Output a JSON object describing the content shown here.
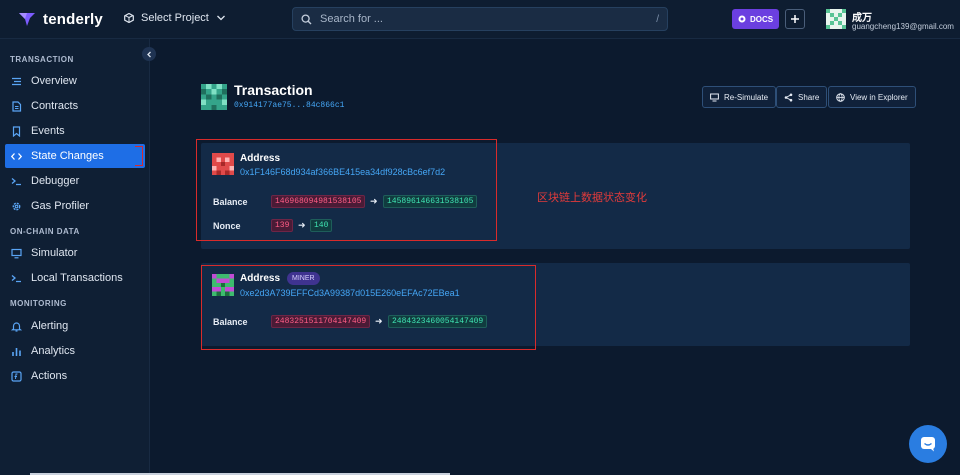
{
  "app": {
    "brand": "tenderly"
  },
  "topbar": {
    "project_label": "Select Project",
    "search_placeholder": "Search for ...",
    "search_shortcut": "/",
    "docs_label": "DOCS",
    "user_name": "成万",
    "user_email": "guangcheng139@gmail.com"
  },
  "sidebar": {
    "sections": [
      {
        "title": "TRANSACTION"
      },
      {
        "title": "ON-CHAIN DATA"
      },
      {
        "title": "MONITORING"
      }
    ],
    "items": [
      {
        "label": "Overview",
        "icon": "list-icon"
      },
      {
        "label": "Contracts",
        "icon": "file-icon"
      },
      {
        "label": "Events",
        "icon": "bookmark-icon"
      },
      {
        "label": "State Changes",
        "icon": "code-icon",
        "active": true
      },
      {
        "label": "Debugger",
        "icon": "terminal-icon"
      },
      {
        "label": "Gas Profiler",
        "icon": "gear-icon"
      },
      {
        "label": "Simulator",
        "icon": "monitor-icon"
      },
      {
        "label": "Local Transactions",
        "icon": "terminal-icon"
      },
      {
        "label": "Alerting",
        "icon": "bell-icon"
      },
      {
        "label": "Analytics",
        "icon": "bar-chart-icon"
      },
      {
        "label": "Actions",
        "icon": "function-icon"
      }
    ]
  },
  "transaction": {
    "title": "Transaction",
    "hash": "0x914177ae75...84c866c1",
    "buttons": {
      "resimulate": "Re-Simulate",
      "share": "Share",
      "explorer": "View in Explorer"
    }
  },
  "state_changes": [
    {
      "label": "Address",
      "address": "0x1F146F68d934af366BE415ea34df928cBc6ef7d2",
      "balance": {
        "label": "Balance",
        "old": "146968094981538105",
        "new": "145896146631538105"
      },
      "nonce": {
        "label": "Nonce",
        "old": "139",
        "new": "140"
      }
    },
    {
      "label": "Address",
      "badge": "MINER",
      "address": "0xe2d3A739EFFCd3A99387d015E260eEFAc72EBea1",
      "balance": {
        "label": "Balance",
        "old": "2483251511704147409",
        "new": "2484323460054147409"
      }
    }
  ],
  "annotation": {
    "text": "区块链上数据状态变化"
  },
  "colors": {
    "accent": "#1e6ee6",
    "docs": "#6b3fe0",
    "old_value": "#ff5d86",
    "new_value": "#3fe3b1",
    "link": "#45a6f5",
    "annotation": "#d92b2b"
  }
}
